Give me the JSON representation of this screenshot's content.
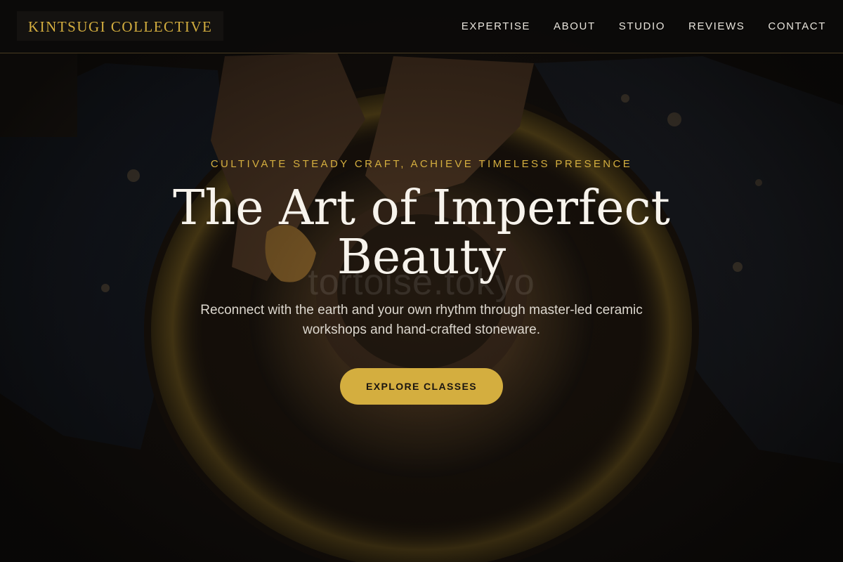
{
  "brand": {
    "name": "KINTSUGI COLLECTIVE",
    "accent_color": "#d4ae3f"
  },
  "nav": {
    "items": [
      {
        "label": "EXPERTISE"
      },
      {
        "label": "ABOUT"
      },
      {
        "label": "STUDIO"
      },
      {
        "label": "REVIEWS"
      },
      {
        "label": "CONTACT"
      }
    ]
  },
  "hero": {
    "eyebrow": "CULTIVATE STEADY CRAFT, ACHIEVE TIMELESS PRESENCE",
    "headline": "The Art of Imperfect Beauty",
    "subtext": "Reconnect with the earth and your own rhythm through master-led ceramic workshops and hand-crafted stoneware.",
    "cta_label": "EXPLORE CLASSES",
    "watermark": "tortoise.tokyo",
    "background_image": "pottery-wheel-hands-photo"
  }
}
